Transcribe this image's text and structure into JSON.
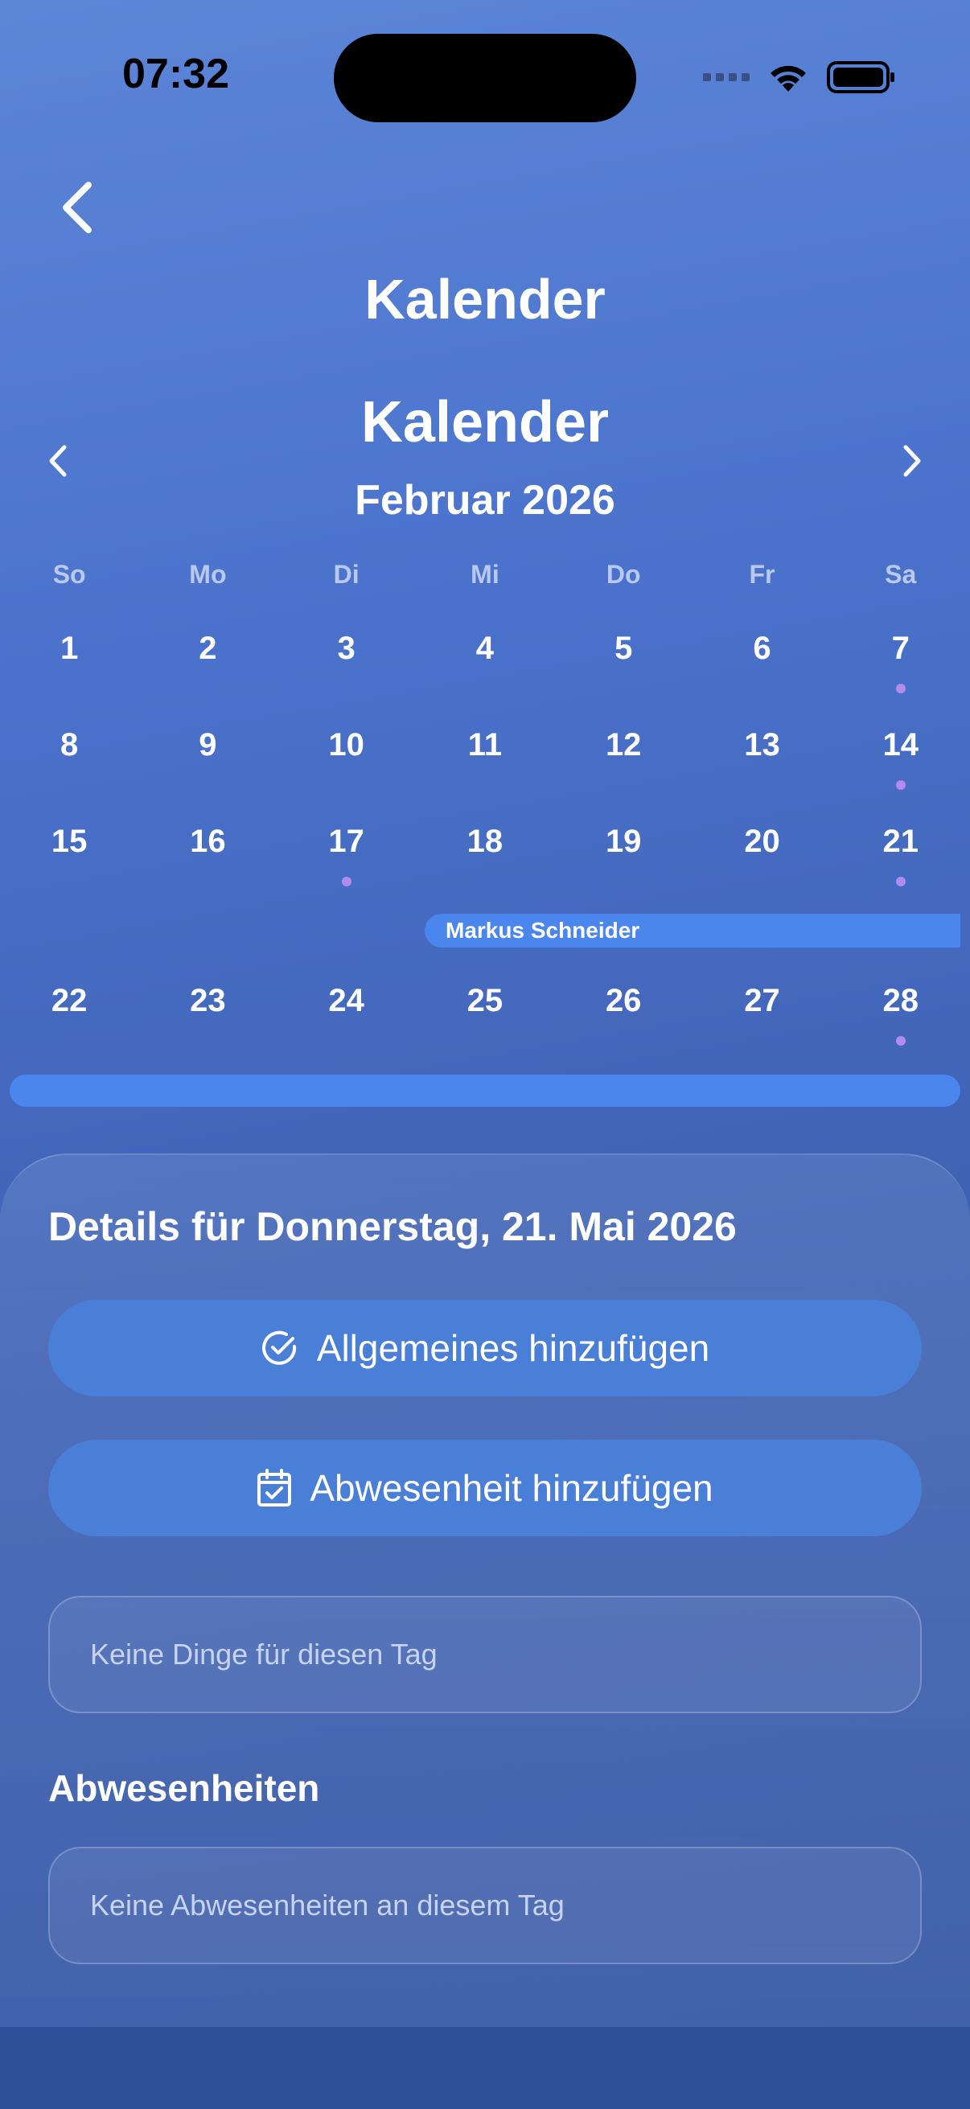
{
  "status_bar": {
    "time": "07:32"
  },
  "header": {
    "title": "Kalender"
  },
  "calendar": {
    "title": "Kalender",
    "month_label": "Februar 2026",
    "weekdays": [
      "So",
      "Mo",
      "Di",
      "Mi",
      "Do",
      "Fr",
      "Sa"
    ],
    "weeks": [
      [
        "1",
        "2",
        "3",
        "4",
        "5",
        "6",
        "7"
      ],
      [
        "8",
        "9",
        "10",
        "11",
        "12",
        "13",
        "14"
      ],
      [
        "15",
        "16",
        "17",
        "18",
        "19",
        "20",
        "21"
      ],
      [
        "22",
        "23",
        "24",
        "25",
        "26",
        "27",
        "28"
      ]
    ],
    "days_with_dot": [
      "7",
      "14",
      "17",
      "21",
      "28"
    ],
    "event_label": "Markus Schneider",
    "event_color": "#4a86ee",
    "dot_color": "#b18cf0"
  },
  "details": {
    "title": "Details für Donnerstag, 21. Mai 2026",
    "add_general_label": "Allgemeines hinzufügen",
    "add_absence_label": "Abwesenheit hinzufügen",
    "no_things_text": "Keine Dinge für diesen Tag",
    "absences_title": "Abwesenheiten",
    "no_absences_text": "Keine Abwesenheiten an diesem Tag"
  }
}
